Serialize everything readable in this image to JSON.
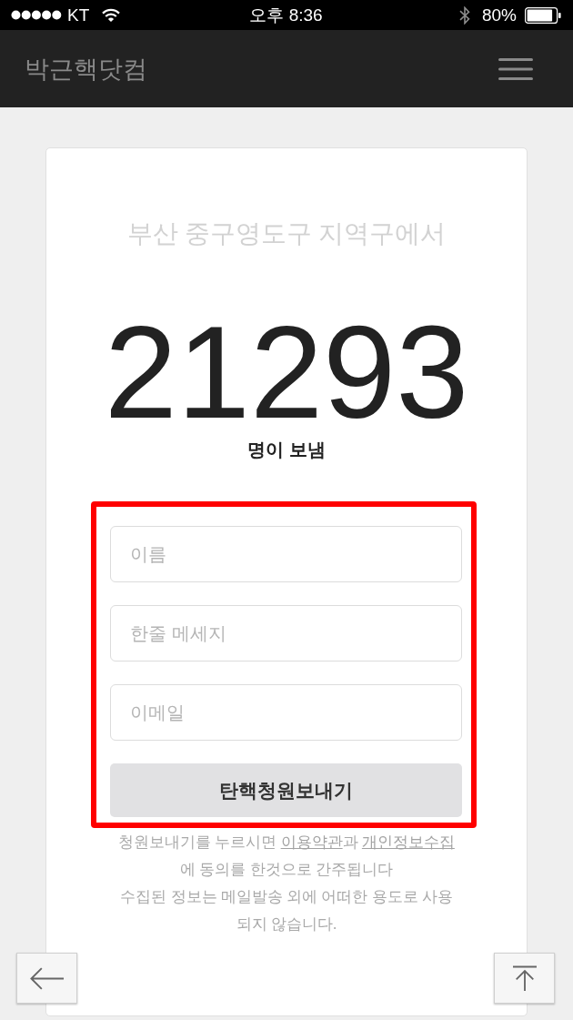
{
  "status_bar": {
    "carrier": "KT",
    "time": "오후 8:36",
    "battery": "80%"
  },
  "header": {
    "title": "박근핵닷컴"
  },
  "card": {
    "region": "부산 중구영도구 지역구에서",
    "count": "21293",
    "count_label": "명이 보냄"
  },
  "form": {
    "highlighted": true,
    "fields": [
      {
        "placeholder": "이름"
      },
      {
        "placeholder": "한줄 메세지"
      },
      {
        "placeholder": "이메일"
      }
    ],
    "submit": "탄핵청원보내기"
  },
  "consent_note": [
    {
      "kind": "text",
      "text": "청원보내기를 누르시면 "
    },
    {
      "kind": "link",
      "text": "이용약관"
    },
    {
      "kind": "text",
      "text": "과 "
    },
    {
      "kind": "link",
      "text": "개인정보수집"
    },
    {
      "kind": "text",
      "text": "에 동의를 한것으로 간주됩니다"
    }
  ],
  "privacy_note": "수집된 정보는 메일발송 외에 어떠한 용도로 사용되지 않습니다.",
  "floating_buttons": [
    {
      "kind": "back"
    },
    {
      "kind": "top"
    }
  ]
}
